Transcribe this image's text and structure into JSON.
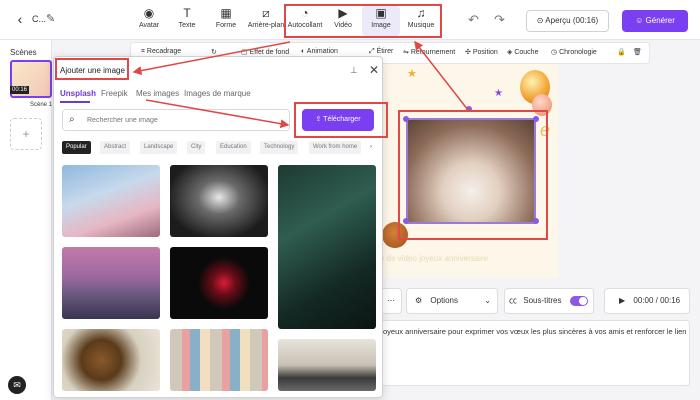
{
  "header": {
    "project_name": "C...",
    "tools": [
      {
        "label": "Avatar",
        "icon": "avatar-icon"
      },
      {
        "label": "Texte",
        "icon": "text-icon"
      },
      {
        "label": "Forme",
        "icon": "shapes-icon"
      },
      {
        "label": "Arrière-plan",
        "icon": "background-icon"
      },
      {
        "label": "Autocollant",
        "icon": "sticker-icon"
      },
      {
        "label": "Vidéo",
        "icon": "video-icon"
      },
      {
        "label": "Image",
        "icon": "image-icon"
      },
      {
        "label": "Musique",
        "icon": "music-icon"
      }
    ],
    "preview_label": "Aperçu (00:16)",
    "generate_label": "Générer"
  },
  "sidebar": {
    "title": "Scènes",
    "scene_time": "00:16",
    "scene_label": "Scène 1",
    "add_label": "+"
  },
  "toolbar": {
    "items": [
      "Recadrage",
      "Effet de fond",
      "Animation",
      "Étirer",
      "Retournement",
      "Position",
      "Couche",
      "Chronologie"
    ]
  },
  "modal": {
    "title": "Ajouter une image",
    "tabs": [
      "Unsplash",
      "Freepik",
      "Mes images",
      "Images de marque"
    ],
    "search_placeholder": "Rechercher une image",
    "upload_label": "Télécharger",
    "chips": [
      "Popular",
      "Abstract",
      "Landscape",
      "City",
      "Education",
      "Technology",
      "Work from home"
    ]
  },
  "canvas": {
    "text_overlay": "e de vidéo joyeux anniversaire"
  },
  "controls": {
    "options_label": "Options",
    "subtitles_label": "Sous-titres",
    "timecode": "00:00 / 00:16"
  },
  "script_text": "oyeux anniversaire pour exprimer vos vœux les plus sincères à vos amis et renforcer le lien",
  "colors": {
    "accent": "#7a3ff0",
    "highlight": "#e04848"
  }
}
